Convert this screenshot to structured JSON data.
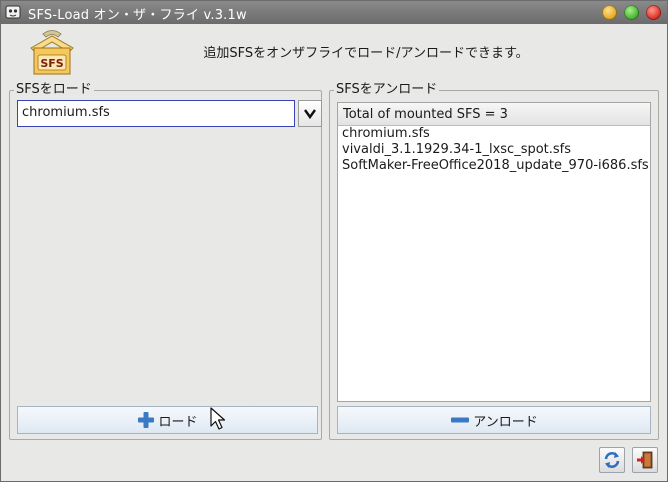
{
  "window": {
    "title": "SFS-Load オン・ザ・フライ v.3.1w"
  },
  "header": {
    "description": "追加SFSをオンザフライでロード/アンロードできます。",
    "icon_label": "SFS"
  },
  "load_panel": {
    "title": "SFSをロード",
    "selected_sfs": "chromium.sfs",
    "load_button": "ロード"
  },
  "unload_panel": {
    "title": "SFSをアンロード",
    "list_header": "Total of mounted SFS = 3",
    "mounted": [
      "chromium.sfs",
      "vivaldi_3.1.1929.34-1_lxsc_spot.sfs",
      "SoftMaker-FreeOffice2018_update_970-i686.sfs"
    ],
    "unload_button": "アンロード"
  },
  "icons": {
    "app": "app-icon",
    "package": "package-icon",
    "plus": "plus-icon",
    "minus": "minus-icon",
    "refresh": "refresh-icon",
    "exit": "exit-icon",
    "dropdown": "chevron-down-icon"
  }
}
